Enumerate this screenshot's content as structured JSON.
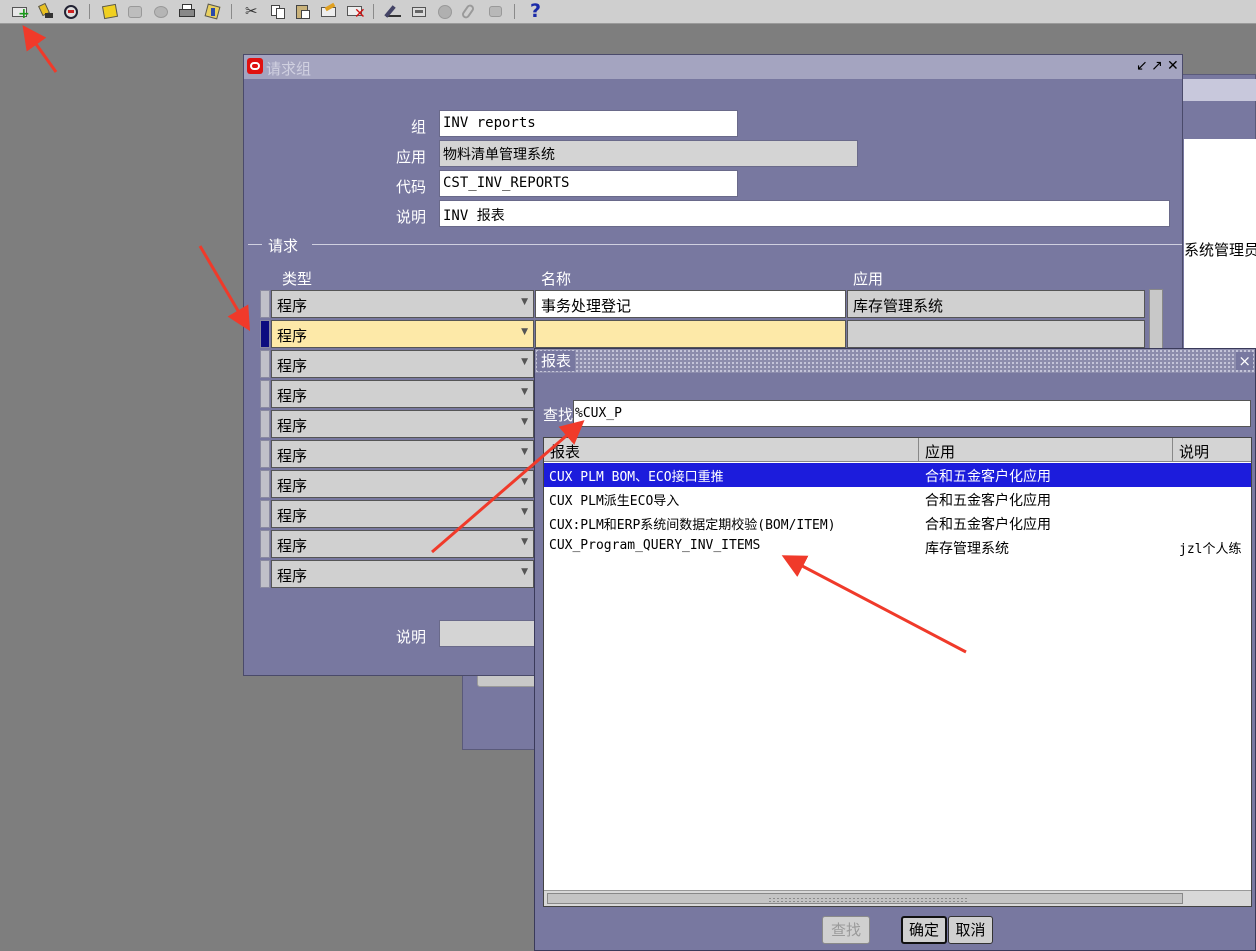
{
  "toolbar": {
    "icons": [
      "new-record-icon",
      "find-icon",
      "navigator-icon",
      "save-icon",
      "next-step-icon",
      "switch-responsibility-icon",
      "print-icon",
      "close-form-icon",
      "cut-icon",
      "copy-icon",
      "paste-icon",
      "clear-record-icon",
      "delete-icon",
      "edit-field-icon",
      "zoom-icon",
      "translations-icon",
      "attachments-icon",
      "folder-tools-icon",
      "help-icon"
    ],
    "help_glyph": "?"
  },
  "background_window": {
    "visible_text": "系统管理员"
  },
  "main_window": {
    "title": "请求组",
    "controls": [
      "minimize",
      "maximize",
      "close"
    ],
    "fields": {
      "group": {
        "label": "组",
        "value": "INV reports"
      },
      "application": {
        "label": "应用",
        "value": "物料清单管理系统"
      },
      "code": {
        "label": "代码",
        "value": "CST_INV_REPORTS"
      },
      "description": {
        "label": "说明",
        "value": "INV 报表"
      }
    },
    "requests_section": {
      "label": "请求",
      "columns": [
        "类型",
        "名称",
        "应用"
      ],
      "rows": [
        {
          "type": "程序",
          "name": "事务处理登记",
          "application": "库存管理系统"
        },
        {
          "type": "程序",
          "name": "",
          "application": ""
        },
        {
          "type": "程序"
        },
        {
          "type": "程序"
        },
        {
          "type": "程序"
        },
        {
          "type": "程序"
        },
        {
          "type": "程序"
        },
        {
          "type": "程序"
        },
        {
          "type": "程序"
        },
        {
          "type": "程序"
        }
      ]
    },
    "bottom_description_label": "说明"
  },
  "lov_dialog": {
    "title": "报表",
    "close_glyph": "×",
    "find_label": "查找",
    "find_value": "%CUX_P",
    "columns": [
      "报表",
      "应用",
      "说明"
    ],
    "rows": [
      {
        "report": "CUX PLM BOM、ECO接口重推",
        "application": "合和五金客户化应用",
        "description": "",
        "selected": true
      },
      {
        "report": "CUX PLM派生ECO导入",
        "application": "合和五金客户化应用",
        "description": ""
      },
      {
        "report": "CUX:PLM和ERP系统间数据定期校验(BOM/ITEM)",
        "application": "合和五金客户化应用",
        "description": ""
      },
      {
        "report": "CUX_Program_QUERY_INV_ITEMS",
        "application": "库存管理系统",
        "description": "jzl个人练"
      }
    ],
    "buttons": {
      "find": "查找",
      "ok": "确定",
      "cancel": "取消"
    }
  },
  "colors": {
    "window_bg": "#7878a0",
    "desktop": "#7e7e7e",
    "selected_row": "#1c1cdc",
    "current_record": "#fde9a8",
    "annotation_arrow": "#f03a2a"
  }
}
